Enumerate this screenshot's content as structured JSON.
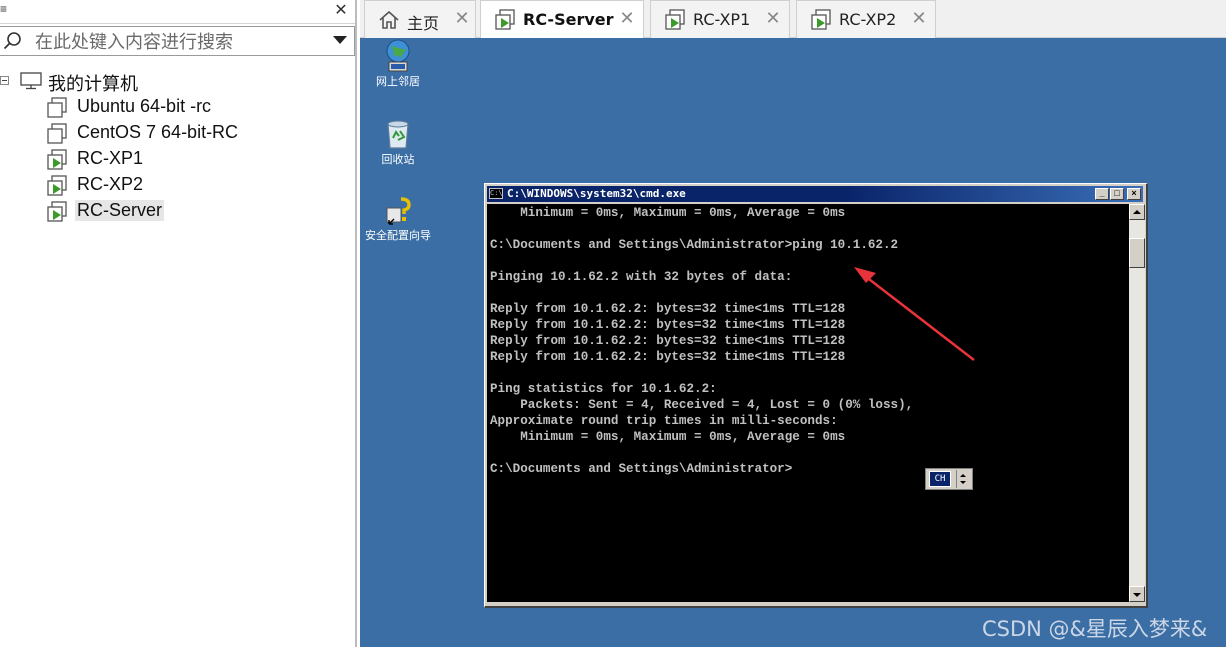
{
  "sidebar": {
    "topbar_mark": "≡",
    "close_glyph": "✕",
    "search_placeholder": "在此处键入内容进行搜索",
    "root_label": "我的计算机",
    "items": [
      {
        "label": "Ubuntu 64-bit -rc",
        "powered": false
      },
      {
        "label": "CentOS 7 64-bit-RC",
        "powered": false
      },
      {
        "label": "RC-XP1",
        "powered": true
      },
      {
        "label": "RC-XP2",
        "powered": true
      },
      {
        "label": "RC-Server",
        "powered": true,
        "selected": true
      }
    ]
  },
  "tabs": [
    {
      "label": "主页",
      "icon": "home-icon",
      "active": false
    },
    {
      "label": "RC-Server",
      "icon": "vm-running-icon",
      "active": true
    },
    {
      "label": "RC-XP1",
      "icon": "vm-running-icon",
      "active": false
    },
    {
      "label": "RC-XP2",
      "icon": "vm-running-icon",
      "active": false
    }
  ],
  "tab_close_glyph": "✕",
  "desktop": {
    "background": "#3a6ea5",
    "icons": [
      {
        "label": "网上邻居",
        "icon": "network-places-icon"
      },
      {
        "label": "回收站",
        "icon": "recycle-bin-icon"
      },
      {
        "label": "安全配置向导",
        "icon": "security-wizard-icon"
      }
    ]
  },
  "cmd": {
    "sys_icon_text": "C:\\",
    "title": "C:\\WINDOWS\\system32\\cmd.exe",
    "lines": [
      "    Minimum = 0ms, Maximum = 0ms, Average = 0ms",
      "",
      "C:\\Documents and Settings\\Administrator>ping 10.1.62.2",
      "",
      "Pinging 10.1.62.2 with 32 bytes of data:",
      "",
      "Reply from 10.1.62.2: bytes=32 time<1ms TTL=128",
      "Reply from 10.1.62.2: bytes=32 time<1ms TTL=128",
      "Reply from 10.1.62.2: bytes=32 time<1ms TTL=128",
      "Reply from 10.1.62.2: bytes=32 time<1ms TTL=128",
      "",
      "Ping statistics for 10.1.62.2:",
      "    Packets: Sent = 4, Received = 4, Lost = 0 (0% loss),",
      "Approximate round trip times in milli-seconds:",
      "    Minimum = 0ms, Maximum = 0ms, Average = 0ms",
      "",
      "C:\\Documents and Settings\\Administrator>"
    ],
    "minimize_glyph": "_",
    "maximize_glyph": "□",
    "close_glyph": "×"
  },
  "ime": {
    "label": "CH"
  },
  "annotation": {
    "color": "#e8333a"
  },
  "watermark": "CSDN @&星辰入梦来&"
}
